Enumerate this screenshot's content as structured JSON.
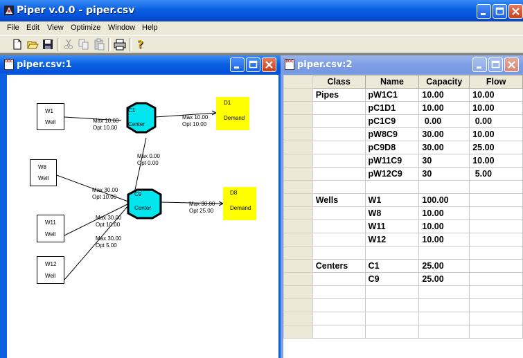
{
  "app": {
    "title": "Piper v.0.0 - piper.csv"
  },
  "menu": [
    "File",
    "Edit",
    "View",
    "Optimize",
    "Window",
    "Help"
  ],
  "toolbar": [
    "new-icon",
    "open-icon",
    "save-icon",
    "cut-icon",
    "copy-icon",
    "paste-icon",
    "print-icon",
    "help-icon"
  ],
  "diagram_window": {
    "title": "piper.csv:1",
    "wells": [
      {
        "id": "w1",
        "name": "W1",
        "type": "Well"
      },
      {
        "id": "w8",
        "name": "W8",
        "type": "Well"
      },
      {
        "id": "w11",
        "name": "W11",
        "type": "Well"
      },
      {
        "id": "w12",
        "name": "W12",
        "type": "Well"
      }
    ],
    "centers": [
      {
        "id": "c1",
        "name": "C1",
        "type": "Center"
      },
      {
        "id": "c9",
        "name": "C9",
        "type": "Center"
      }
    ],
    "demands": [
      {
        "id": "d1",
        "name": "D1",
        "type": "Demand"
      },
      {
        "id": "d8",
        "name": "D8",
        "type": "Demand"
      }
    ],
    "edges": [
      {
        "id": "w1c1",
        "max": "Max 10.00",
        "opt": "Opt 10.00"
      },
      {
        "id": "c1d1",
        "max": "Max 10.00",
        "opt": "Opt 10.00"
      },
      {
        "id": "c1c9",
        "max": "Max  0.00",
        "opt": "Opt  0.00"
      },
      {
        "id": "w8c9",
        "max": "Max 30.00",
        "opt": "Opt 10.00"
      },
      {
        "id": "c9d8",
        "max": "Max 30.00",
        "opt": "Opt 25.00"
      },
      {
        "id": "w11c9",
        "max": "Max 30.00",
        "opt": "Opt 10.00"
      },
      {
        "id": "w12c9",
        "max": "Max 30.00",
        "opt": "Opt  5.00"
      }
    ]
  },
  "table_window": {
    "title": "piper.csv:2",
    "columns": [
      "Class",
      "Name",
      "Capacity",
      "Flow"
    ],
    "rows": [
      [
        "Pipes",
        "pW1C1",
        "10.00",
        "10.00"
      ],
      [
        "",
        "pC1D1",
        "10.00",
        "10.00"
      ],
      [
        "",
        "pC1C9",
        " 0.00",
        " 0.00"
      ],
      [
        "",
        "pW8C9",
        "30.00",
        "10.00"
      ],
      [
        "",
        "pC9D8",
        "30.00",
        "25.00"
      ],
      [
        "",
        "pW11C9",
        "30",
        "10.00"
      ],
      [
        "",
        "pW12C9",
        "30",
        " 5.00"
      ],
      [
        "",
        "",
        "",
        ""
      ],
      [
        "Wells",
        "W1",
        "100.00",
        ""
      ],
      [
        "",
        "W8",
        "10.00",
        ""
      ],
      [
        "",
        "W11",
        "10.00",
        ""
      ],
      [
        "",
        "W12",
        "10.00",
        ""
      ],
      [
        "",
        "",
        "",
        ""
      ],
      [
        "Centers",
        "C1",
        "25.00",
        ""
      ],
      [
        "",
        "C9",
        "25.00",
        ""
      ],
      [
        "",
        "",
        "",
        ""
      ],
      [
        "",
        "",
        "",
        ""
      ],
      [
        "",
        "",
        "",
        ""
      ],
      [
        "",
        "",
        "",
        ""
      ]
    ]
  }
}
